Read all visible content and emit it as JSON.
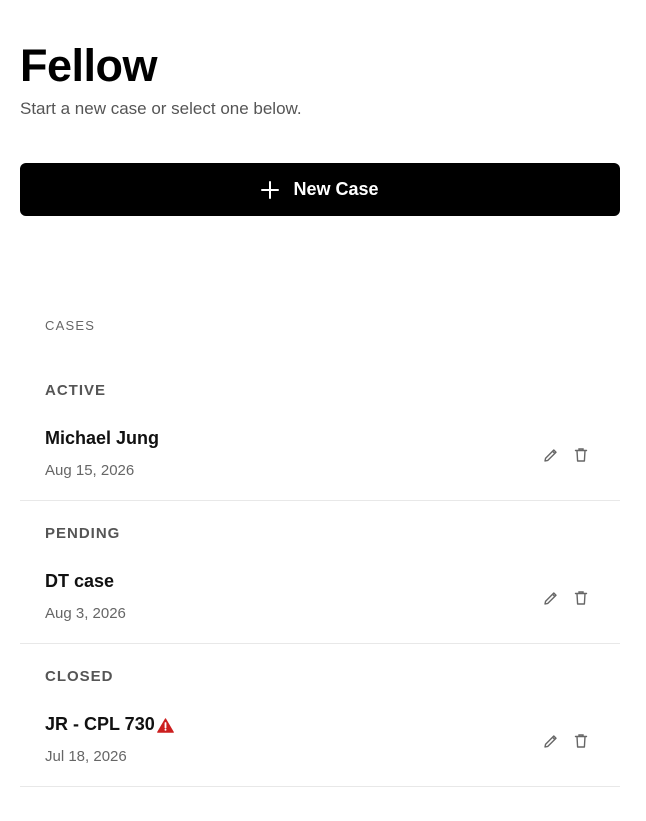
{
  "app": {
    "title": "Fellow",
    "subtitle": "Start a new case or select one below."
  },
  "new_case_button": {
    "label": "New Case",
    "icon": "plus-icon"
  },
  "cases": {
    "heading": "CASES",
    "groups": [
      {
        "label": "ACTIVE",
        "items": [
          {
            "name": "Michael Jung",
            "date": "Aug 15, 2026",
            "warning": false
          }
        ]
      },
      {
        "label": "PENDING",
        "items": [
          {
            "name": "DT case",
            "date": "Aug 3, 2026",
            "warning": false
          }
        ]
      },
      {
        "label": "CLOSED",
        "items": [
          {
            "name": "JR - CPL 730",
            "date": "Jul 18, 2026",
            "warning": true
          }
        ]
      }
    ],
    "row_actions": [
      "pencil-icon",
      "trash-icon"
    ]
  },
  "colors": {
    "button_bg": "#000000",
    "warning": "#cc1f1f",
    "muted_text": "#666666",
    "divider": "#e8e8e8"
  }
}
